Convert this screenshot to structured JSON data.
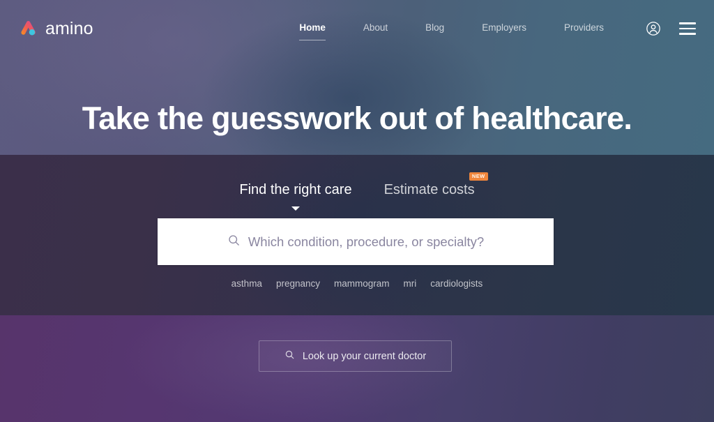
{
  "brand": {
    "name": "amino",
    "logo_icon": "amino-logo-mark",
    "logo_colors": {
      "orange": "#f5873d",
      "pink": "#e8478a",
      "magenta": "#d64ba0",
      "cyan": "#3ec6e0"
    }
  },
  "header": {
    "nav_items": [
      {
        "label": "Home",
        "active": true
      },
      {
        "label": "About",
        "active": false
      },
      {
        "label": "Blog",
        "active": false
      },
      {
        "label": "Employers",
        "active": false
      },
      {
        "label": "Providers",
        "active": false
      }
    ],
    "account_icon": "user-circle-icon",
    "menu_icon": "hamburger-menu-icon"
  },
  "hero": {
    "headline": "Take the guesswork out of healthcare."
  },
  "search": {
    "tabs": [
      {
        "label": "Find the right care",
        "active": true,
        "badge": null
      },
      {
        "label": "Estimate costs",
        "active": false,
        "badge": "NEW"
      }
    ],
    "search_icon": "search-icon",
    "placeholder": "Which condition, procedure, or specialty?",
    "value": "",
    "suggestions": [
      "asthma",
      "pregnancy",
      "mammogram",
      "mri",
      "cardiologists"
    ]
  },
  "bottom": {
    "doctor_lookup_label": "Look up your current doctor",
    "doctor_lookup_icon": "search-icon"
  },
  "colors": {
    "badge_orange": "#f0863c",
    "search_box_bg": "#ffffff",
    "placeholder_text": "#8a86a0",
    "band_top_left": "#5d5b80",
    "band_top_right": "#456b80",
    "band_mid_left": "#3b2f4a",
    "band_mid_right": "#28374b",
    "band_bottom_left": "#57346b",
    "band_bottom_right": "#3d3f5e"
  }
}
